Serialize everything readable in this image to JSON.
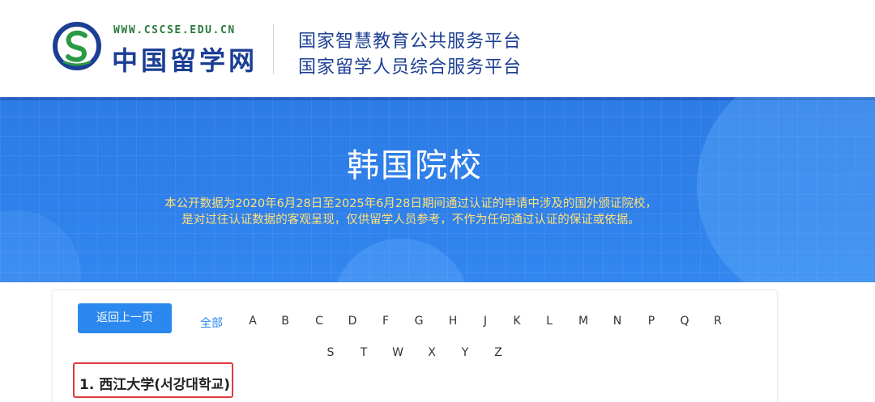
{
  "header": {
    "logo_url_text": "WWW.CSCSE.EDU.CN",
    "logo_name": "中国留学网",
    "logo_icon": "cscse-logo-icon",
    "platform_lines": [
      "国家智慧教育公共服务平台",
      "国家留学人员综合服务平台"
    ]
  },
  "banner": {
    "title": "韩国院校",
    "description_lines": [
      "本公开数据为2020年6月28日至2025年6月28日期间通过认证的申请中涉及的国外颁证院校，",
      "是对过往认证数据的客观呈现，仅供留学人员参考，不作为任何通过认证的保证或依据。"
    ]
  },
  "filter": {
    "back_label": "返回上一页",
    "all_label": "全部",
    "letters_row1": [
      "A",
      "B",
      "C",
      "D",
      "F",
      "G",
      "H",
      "J",
      "K",
      "L",
      "M",
      "N",
      "P",
      "Q",
      "R"
    ],
    "letters_row2": [
      "S",
      "T",
      "W",
      "X",
      "Y",
      "Z"
    ]
  },
  "schools": [
    {
      "index": "1.",
      "name": "西江大学(서강대학교)"
    }
  ],
  "colors": {
    "primary_blue": "#2b88ee",
    "banner_blue": "#2f80ea",
    "brand_navy": "#1c3f94",
    "brand_green": "#2b7a3e",
    "notice_yellow": "#ffe17a",
    "highlight_red": "#e0393e"
  }
}
